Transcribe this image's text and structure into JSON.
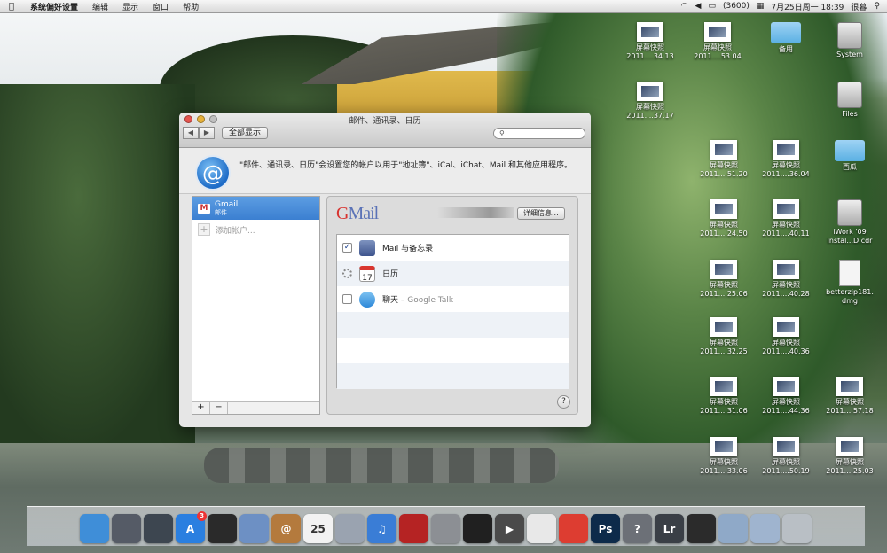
{
  "menubar": {
    "app_name": "系统偏好设置",
    "items": [
      "编辑",
      "显示",
      "窗口",
      "帮助"
    ],
    "clock": "7月25日周一  18:39",
    "user": "很暮",
    "battery_text": "(3600)"
  },
  "desktop_icons": [
    {
      "label": "屏幕快照",
      "sub": "2011....34.13",
      "kind": "thumb"
    },
    {
      "label": "屏幕快照",
      "sub": "2011....53.04",
      "kind": "thumb"
    },
    {
      "label": "备用",
      "sub": "",
      "kind": "folder"
    },
    {
      "label": "System",
      "sub": "",
      "kind": "drive"
    },
    {
      "label": "屏幕快照",
      "sub": "2011....37.17",
      "kind": "thumb"
    },
    {
      "label": "Files",
      "sub": "",
      "kind": "drive"
    },
    {
      "label": "屏幕快照",
      "sub": "2011....51.20",
      "kind": "thumb"
    },
    {
      "label": "屏幕快照",
      "sub": "2011....36.04",
      "kind": "thumb"
    },
    {
      "label": "西瓜",
      "sub": "",
      "kind": "folder"
    },
    {
      "label": "屏幕快照",
      "sub": "2011....24.50",
      "kind": "thumb"
    },
    {
      "label": "屏幕快照",
      "sub": "2011....40.11",
      "kind": "thumb"
    },
    {
      "label": "iWork '09",
      "sub": "Instal...D.cdr",
      "kind": "drive"
    },
    {
      "label": "屏幕快照",
      "sub": "2011....25.06",
      "kind": "thumb"
    },
    {
      "label": "屏幕快照",
      "sub": "2011....40.28",
      "kind": "thumb"
    },
    {
      "label": "betterzip181.",
      "sub": "dmg",
      "kind": "doc"
    },
    {
      "label": "屏幕快照",
      "sub": "2011....32.25",
      "kind": "thumb"
    },
    {
      "label": "屏幕快照",
      "sub": "2011....40.36",
      "kind": "thumb"
    },
    {
      "label": "屏幕快照",
      "sub": "2011....31.06",
      "kind": "thumb"
    },
    {
      "label": "屏幕快照",
      "sub": "2011....44.36",
      "kind": "thumb"
    },
    {
      "label": "屏幕快照",
      "sub": "2011....57.18",
      "kind": "thumb"
    },
    {
      "label": "屏幕快照",
      "sub": "2011....33.06",
      "kind": "thumb"
    },
    {
      "label": "屏幕快照",
      "sub": "2011....50.19",
      "kind": "thumb"
    },
    {
      "label": "屏幕快照",
      "sub": "2011....25.03",
      "kind": "thumb"
    }
  ],
  "window": {
    "title": "邮件、通讯录、日历",
    "show_all": "全部显示",
    "search_placeholder": "",
    "info_text": "\"邮件、通讯录、日历\"会设置您的帐户以用于\"地址簿\"、iCal、iChat、Mail 和其他应用程序。",
    "at_symbol": "@",
    "accounts": [
      {
        "name": "Gmail",
        "type": "邮件"
      }
    ],
    "add_account": "添加帐户...",
    "add_button": "+",
    "remove_button": "−",
    "gmail_logo_g": "G",
    "gmail_logo_rest": "Mail",
    "details_button": "详细信息...",
    "services": [
      {
        "label": "Mail 与备忘录",
        "state": "checked",
        "icon": "mail-icon"
      },
      {
        "label": "日历",
        "state": "loading",
        "icon": "calendar-icon",
        "icon_text": "17"
      },
      {
        "label": "聊天",
        "label_suffix": " – Google Talk",
        "state": "unchecked",
        "icon": "chat-icon"
      }
    ],
    "help": "?"
  },
  "dock": {
    "items": [
      {
        "name": "finder",
        "color": "#3f8ed8",
        "text": ""
      },
      {
        "name": "launchpad",
        "color": "#555b66",
        "text": ""
      },
      {
        "name": "mission-control",
        "color": "#3d4650",
        "text": ""
      },
      {
        "name": "app-store",
        "color": "#2a7fe0",
        "text": "A",
        "badge": "3"
      },
      {
        "name": "dashboard",
        "color": "#2a2a2a",
        "text": ""
      },
      {
        "name": "preview",
        "color": "#6d90c4",
        "text": ""
      },
      {
        "name": "address-book",
        "color": "#b47a3d",
        "text": "@"
      },
      {
        "name": "ical",
        "color": "#f2f2f2",
        "text": "25"
      },
      {
        "name": "iphoto",
        "color": "#9aa3b0",
        "text": ""
      },
      {
        "name": "itunes",
        "color": "#3a7dd6",
        "text": "♫"
      },
      {
        "name": "photo-booth",
        "color": "#b52323",
        "text": ""
      },
      {
        "name": "system-preferences",
        "color": "#8c8f94",
        "text": ""
      },
      {
        "name": "qq",
        "color": "#202020",
        "text": ""
      },
      {
        "name": "dvd-player",
        "color": "#4a4a4a",
        "text": "▶"
      },
      {
        "name": "picasa",
        "color": "#e8e8e8",
        "text": ""
      },
      {
        "name": "chrome",
        "color": "#dd3d31",
        "text": ""
      },
      {
        "name": "photoshop",
        "color": "#0d2a4a",
        "text": "Ps"
      },
      {
        "name": "help",
        "color": "#6c7077",
        "text": "?"
      },
      {
        "name": "lightroom",
        "color": "#3a3f46",
        "text": "Lr"
      },
      {
        "name": "camera",
        "color": "#2b2b2b",
        "text": ""
      },
      {
        "name": "applications-folder",
        "color": "#8fa9c8",
        "text": ""
      },
      {
        "name": "documents-folder",
        "color": "#9fb4cf",
        "text": ""
      },
      {
        "name": "trash",
        "color": "#b9bfc5",
        "text": ""
      }
    ]
  }
}
